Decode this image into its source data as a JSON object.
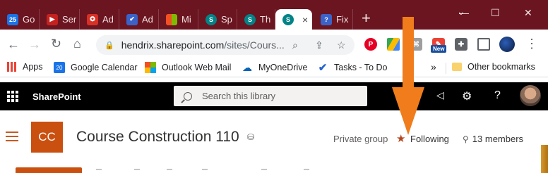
{
  "browser": {
    "tabs": [
      {
        "label": "Go",
        "favicon": "calendar-icon",
        "color": "#1a73e8",
        "glyph": "25"
      },
      {
        "label": "Ser",
        "favicon": "video-icon",
        "color": "#c5221f",
        "glyph": "▶"
      },
      {
        "label": "Ad",
        "favicon": "mortarboard-icon",
        "color": "#d93025",
        "glyph": "✪"
      },
      {
        "label": "Ad",
        "favicon": "checkmark-icon",
        "color": "#3b62c9",
        "glyph": "✔"
      },
      {
        "label": "Mi",
        "favicon": "microsoft-icon",
        "color": "#f25022",
        "glyph": "■"
      },
      {
        "label": "Sp",
        "favicon": "sharepoint-icon",
        "color": "#038387",
        "glyph": "S"
      },
      {
        "label": "Th",
        "favicon": "sharepoint-icon",
        "color": "#038387",
        "glyph": "S"
      },
      {
        "label": "×",
        "favicon": "sharepoint-icon",
        "color": "#038387",
        "glyph": "S",
        "active": true
      },
      {
        "label": "Fix",
        "favicon": "help-icon",
        "color": "#3b62c9",
        "glyph": "?"
      }
    ],
    "new_tab_glyph": "+",
    "window_controls": {
      "chevron": "⌄",
      "minimize": "—",
      "maximize": "☐",
      "close": "✕"
    },
    "address": {
      "host": "hendrix.sharepoint.com",
      "path": "/sites/Cours..."
    },
    "new_badge": "New"
  },
  "bookmarks": [
    {
      "label": "Apps",
      "icon": "apps-grid-icon"
    },
    {
      "label": "Google Calendar",
      "icon": "calendar-icon"
    },
    {
      "label": "Outlook Web Mail",
      "icon": "microsoft-icon"
    },
    {
      "label": "MyOneDrive",
      "icon": "cloud-icon"
    },
    {
      "label": "Tasks - To Do",
      "icon": "checkmark-icon"
    }
  ],
  "bookmarks_overflow": "»",
  "other_bookmarks": "Other bookmarks",
  "suitebar": {
    "brand": "SharePoint",
    "search_placeholder": "Search this library",
    "megaphone": "📢",
    "settings": "⚙",
    "help": "?"
  },
  "site": {
    "logo_initials": "CC",
    "title": "Course Construction 110",
    "privacy": "Private group",
    "follow_label": "Following",
    "members_label": "13 members"
  },
  "colors": {
    "tab_strip": "#6b1520",
    "site_accent": "#ca5010",
    "annotation_arrow": "#f07c1c"
  }
}
